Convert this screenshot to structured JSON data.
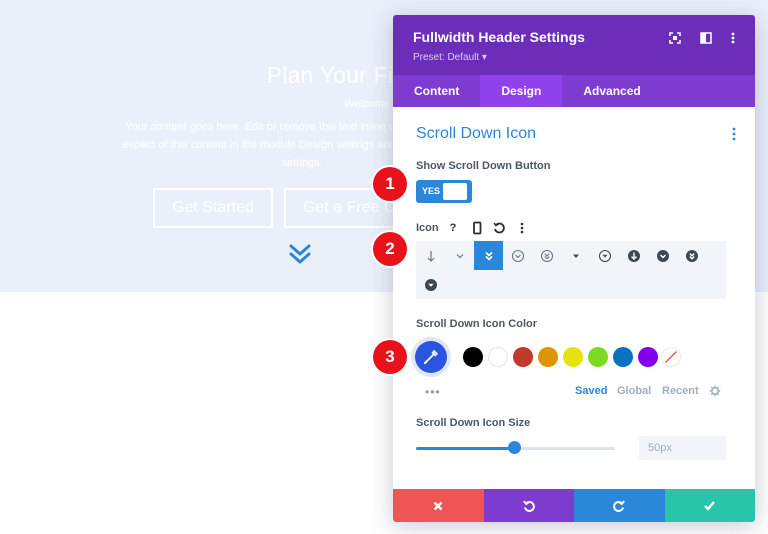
{
  "background": {
    "title": "Plan Your Financial Fu",
    "subtitle": "Welcome to Divi",
    "body_line1": "Your content goes here. Edit or remove this text inline or in the module C",
    "body_line2": "espect of this content in the module Design settings and even apply custo",
    "body_line3": "settings.",
    "button1": "Get Started",
    "button2": "Get a Free C"
  },
  "panel": {
    "title": "Fullwidth Header Settings",
    "preset": "Preset: Default ▾",
    "tabs": [
      {
        "label": "Content"
      },
      {
        "label": "Design"
      },
      {
        "label": "Advanced"
      }
    ],
    "active_tab": "Design",
    "section_title": "Scroll Down Icon",
    "show_button_label": "Show Scroll Down Button",
    "toggle_value": "YES",
    "icon_label": "Icon",
    "icon_tools": [
      "?",
      "▯",
      "↺",
      "⋮"
    ],
    "color_label": "Scroll Down Icon Color",
    "swatch_colors": [
      "#000000",
      "#ffffff",
      "#c0392b",
      "#e09400",
      "#e6e20b",
      "#7cda24",
      "#0c71c3",
      "#8300e9"
    ],
    "color_tabs": [
      "Saved",
      "Global",
      "Recent"
    ],
    "more": "•••",
    "size_label": "Scroll Down Icon Size",
    "size_value": "50px",
    "size_fraction": 0.49,
    "footer_colors": [
      "#ef5555",
      "#7e3bd0",
      "#2b87da",
      "#29c4a9"
    ]
  },
  "markers": [
    "1",
    "2",
    "3"
  ]
}
